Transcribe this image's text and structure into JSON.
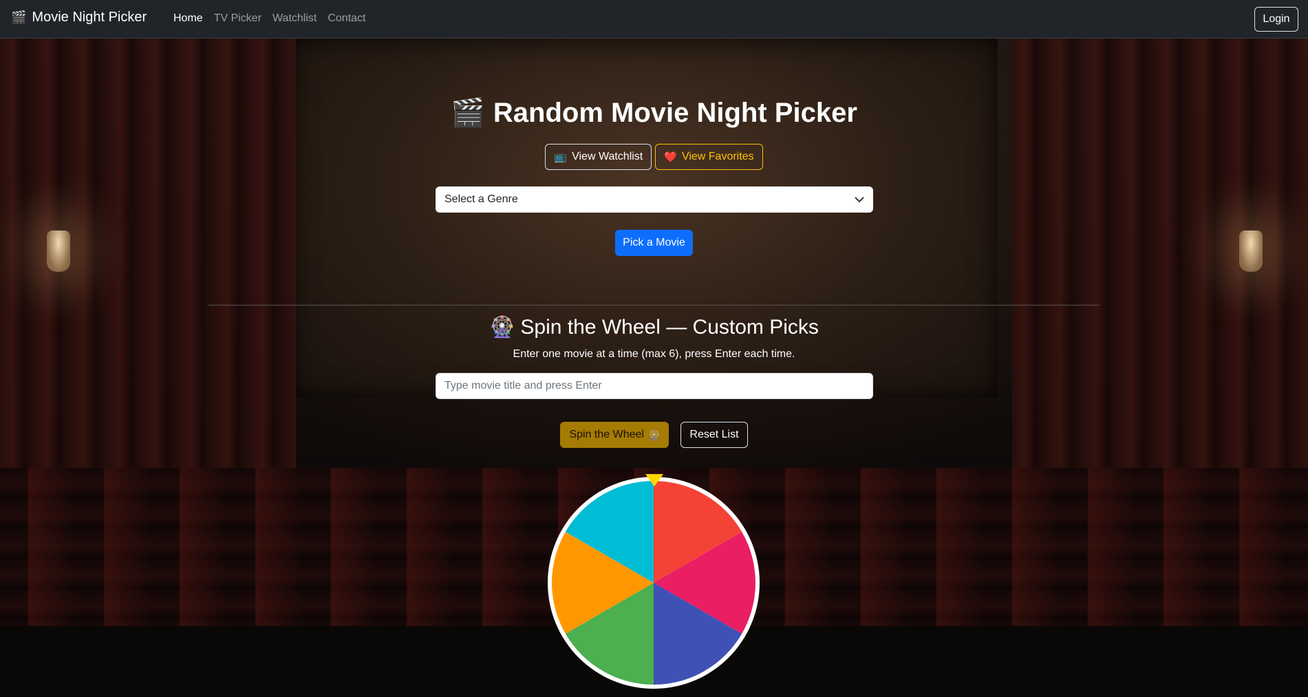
{
  "navbar": {
    "brand_icon": "🎬",
    "brand": "Movie Night Picker",
    "links": [
      {
        "label": "Home",
        "active": true
      },
      {
        "label": "TV Picker",
        "active": false
      },
      {
        "label": "Watchlist",
        "active": false
      },
      {
        "label": "Contact",
        "active": false
      }
    ],
    "login_label": "Login"
  },
  "hero": {
    "icon": "🎬",
    "title": "Random Movie Night Picker",
    "watchlist_icon": "📺",
    "watchlist_label": "View Watchlist",
    "favorites_icon": "❤️",
    "favorites_label": "View Favorites",
    "genre_select": "Select a Genre",
    "pick_label": "Pick a Movie"
  },
  "wheel_section": {
    "icon": "🎡",
    "title": "Spin the Wheel — Custom Picks",
    "subtitle": "Enter one movie at a time (max 6), press Enter each time.",
    "input_placeholder": "Type movie title and press Enter",
    "spin_label": "Spin the Wheel",
    "spin_icon": "🎡",
    "reset_label": "Reset List",
    "segment_colors": [
      "#F44336",
      "#E91E63",
      "#3F51B5",
      "#4CAF50",
      "#FF9800",
      "#00BCD4"
    ],
    "pointer_color": "#FFD700"
  }
}
